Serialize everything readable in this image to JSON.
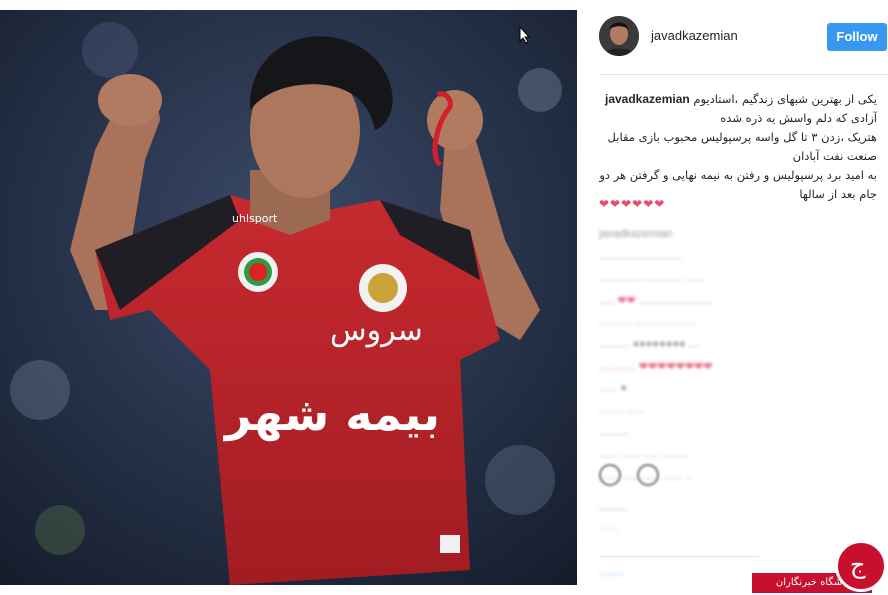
{
  "post": {
    "username": "javadkazemian",
    "follow_label": "Follow",
    "caption_user": "javadkazemian",
    "caption_lines": [
      "یکی از بهترین شبهای زندگیم ،استادیوم",
      "آزادی که دلم واسش یه ذره شده",
      "هتریک ،زدن ۳ تا گل واسه پرسپولیس محبوب بازی مقابل",
      "صنعت نفت آبادان",
      "به امید برد پرسپولیس و رفتن به نیمه نهایی و گرفتن هر دو",
      "جام بعد از سالها"
    ],
    "hearts": "❤❤❤❤❤❤"
  },
  "comments": [
    {
      "text": "javadkazemian",
      "pink": false
    },
    {
      "text": "...........................",
      "pink": false
    },
    {
      "text": "............. ............. ......",
      "pink": false
    },
    {
      "text": "..... ❤❤ ........................",
      "pink": true
    },
    {
      "text": "........... ....................",
      "pink": false
    },
    {
      "text": ".......... ●●●●●●●● ....",
      "pink": false
    },
    {
      "text": "............ ❤❤❤❤❤❤❤❤",
      "pink": true
    },
    {
      "text": "...... ●",
      "pink": false
    },
    {
      "text": "........ ......",
      "pink": false
    },
    {
      "text": "..........",
      "pink": false
    },
    {
      "text": "...... ...... ...... ........",
      "pink": false
    },
    {
      "text": "...... ...... ...... ...... ...",
      "pink": false
    }
  ],
  "jersey": {
    "sponsor_top": "سروس",
    "sponsor_bottom": "بیمه شهر",
    "brand": "uhlsport"
  },
  "footer": {
    "likes_text": "........",
    "time_text": "......",
    "login_text": "......."
  },
  "watermark": {
    "label": "باشگاه خبرنگاران",
    "logo_glyph": "ج"
  },
  "colors": {
    "follow_blue": "#3897f0",
    "jersey_red": "#c8202a",
    "heart_pink": "#ed4a6e",
    "watermark_red": "#c8102e"
  }
}
